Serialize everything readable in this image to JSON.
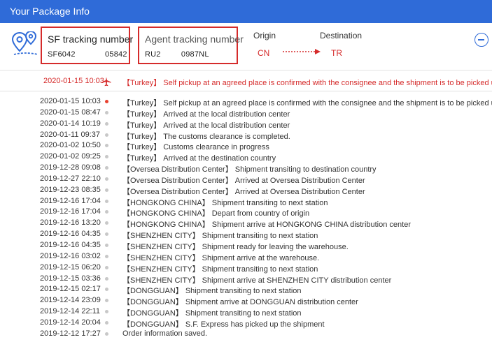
{
  "window": {
    "title": "Your Package Info"
  },
  "sf_box": {
    "label": "SF tracking number",
    "value": "SF6042             05842"
  },
  "agent_box": {
    "label": "Agent tracking number",
    "value": "RU2         0987NL"
  },
  "route": {
    "origin_header": "Origin",
    "destination_header": "Destination",
    "origin_code": "CN",
    "destination_code": "TR"
  },
  "colors": {
    "title_bar": "#2f6bd8",
    "highlight": "#d52b2b",
    "active_dot": "#e8412f",
    "inactive_dot": "#c8c8c8"
  },
  "latest": {
    "time": "2020-01-15 10:03",
    "message": "【Turkey】 Self pickup at an agreed place is confirmed with the consignee and the shipment is to be picked up.",
    "icon": "plane-icon"
  },
  "events": [
    {
      "time": "2020-01-15 10:03",
      "message": "【Turkey】 Self pickup at an agreed place is confirmed with the consignee and the shipment is to be picked up.",
      "active": true
    },
    {
      "time": "2020-01-15 08:47",
      "message": "【Turkey】 Arrived at the local distribution center"
    },
    {
      "time": "2020-01-14 10:19",
      "message": "【Turkey】 Arrived at the local distribution center"
    },
    {
      "time": "2020-01-11 09:37",
      "message": "【Turkey】 The customs clearance is completed."
    },
    {
      "time": "2020-01-02 10:50",
      "message": "【Turkey】 Customs clearance in progress"
    },
    {
      "time": "2020-01-02 09:25",
      "message": "【Turkey】 Arrived at the destination country"
    },
    {
      "time": "2019-12-28 09:08",
      "message": "【Oversea Distribution Center】 Shipment transiting to destination country"
    },
    {
      "time": "2019-12-27 22:10",
      "message": "【Oversea Distribution Center】 Arrived at Oversea Distribution Center"
    },
    {
      "time": "2019-12-23 08:35",
      "message": "【Oversea Distribution Center】 Arrived at Oversea Distribution Center"
    },
    {
      "time": "2019-12-16 17:04",
      "message": "【HONGKONG CHINA】 Shipment transiting to next station"
    },
    {
      "time": "2019-12-16 17:04",
      "message": "【HONGKONG CHINA】 Depart from country of origin"
    },
    {
      "time": "2019-12-16 13:20",
      "message": "【HONGKONG CHINA】 Shipment arrive at HONGKONG CHINA distribution center"
    },
    {
      "time": "2019-12-16 04:35",
      "message": "【SHENZHEN CITY】 Shipment transiting to next station"
    },
    {
      "time": "2019-12-16 04:35",
      "message": "【SHENZHEN CITY】 Shipment ready for leaving the warehouse."
    },
    {
      "time": "2019-12-16 03:02",
      "message": "【SHENZHEN CITY】 Shipment arrive at the warehouse."
    },
    {
      "time": "2019-12-15 06:20",
      "message": "【SHENZHEN CITY】 Shipment transiting to next station"
    },
    {
      "time": "2019-12-15 03:36",
      "message": "【SHENZHEN CITY】 Shipment arrive at SHENZHEN CITY distribution center"
    },
    {
      "time": "2019-12-15 02:17",
      "message": "【DONGGUAN】 Shipment transiting to next station"
    },
    {
      "time": "2019-12-14 23:09",
      "message": "【DONGGUAN】 Shipment arrive at DONGGUAN distribution center"
    },
    {
      "time": "2019-12-14 22:11",
      "message": "【DONGGUAN】 Shipment transiting to next station"
    },
    {
      "time": "2019-12-14 20:04",
      "message": "【DONGGUAN】 S.F. Express has picked up the shipment"
    },
    {
      "time": "2019-12-12 17:27",
      "message": "Order information saved."
    }
  ]
}
